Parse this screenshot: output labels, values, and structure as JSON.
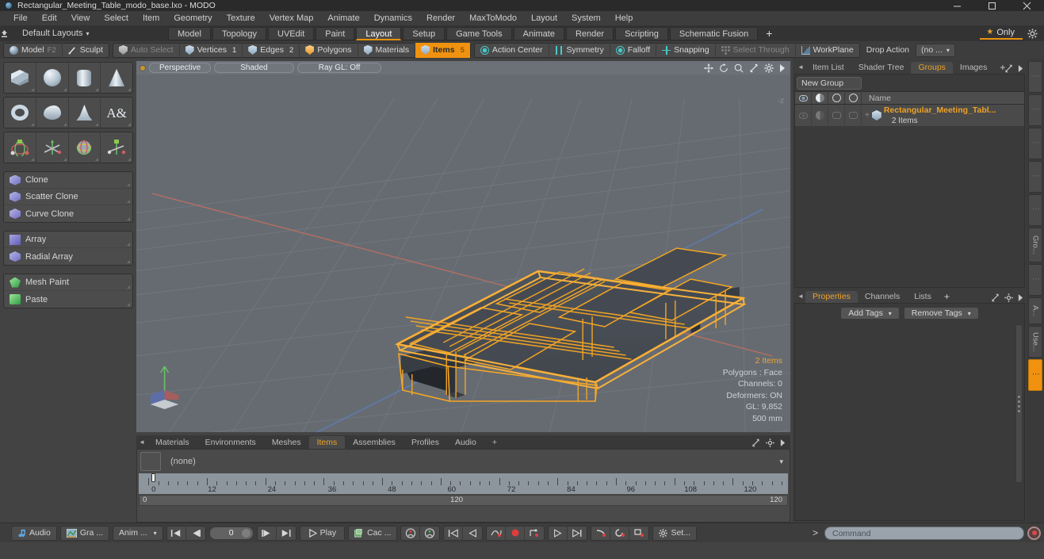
{
  "window": {
    "title": "Rectangular_Meeting_Table_modo_base.lxo - MODO",
    "app_icon": "modo-logo-icon",
    "minimize": "–",
    "maximize": "□",
    "close": "✕"
  },
  "menubar": {
    "items": [
      "File",
      "Edit",
      "View",
      "Select",
      "Item",
      "Geometry",
      "Texture",
      "Vertex Map",
      "Animate",
      "Dynamics",
      "Render",
      "MaxToModo",
      "Layout",
      "System",
      "Help"
    ]
  },
  "layout_bar": {
    "preset_label": "Default Layouts",
    "preset_caret": "▾",
    "tabs": [
      {
        "label": "Model",
        "active": false
      },
      {
        "label": "Topology",
        "active": false
      },
      {
        "label": "UVEdit",
        "active": false
      },
      {
        "label": "Paint",
        "active": false
      },
      {
        "label": "Layout",
        "active": true
      },
      {
        "label": "Setup",
        "active": false
      },
      {
        "label": "Game Tools",
        "active": false
      },
      {
        "label": "Animate",
        "active": false
      },
      {
        "label": "Render",
        "active": false
      },
      {
        "label": "Scripting",
        "active": false
      },
      {
        "label": "Schematic Fusion",
        "active": false
      }
    ],
    "add_tab": "+",
    "only_label": "Only",
    "only_star": "★",
    "gear": "gear-icon"
  },
  "mode_toolbar": {
    "left_group": [
      {
        "label": "Model",
        "icon": "sphere-icon",
        "shortcut": "F2",
        "state": "normal"
      },
      {
        "label": "Sculpt",
        "icon": "brush-icon",
        "shortcut": "",
        "state": "normal"
      }
    ],
    "selection_group": [
      {
        "label": "Auto Select",
        "icon": "shield-icon",
        "count": "",
        "state": "dim"
      },
      {
        "label": "Vertices",
        "icon": "shield-icon",
        "count": "1",
        "state": "normal"
      },
      {
        "label": "Edges",
        "icon": "shield-icon",
        "count": "2",
        "state": "normal"
      },
      {
        "label": "Polygons",
        "icon": "shield-icon",
        "count": "",
        "state": "normal"
      },
      {
        "label": "Materials",
        "icon": "shield-icon",
        "count": "",
        "state": "normal"
      },
      {
        "label": "Items",
        "icon": "shield-icon",
        "count": "5",
        "state": "active"
      }
    ],
    "right_group": [
      {
        "label": "Action Center",
        "icon": "action-center-icon",
        "state": "normal"
      },
      {
        "label": "Symmetry",
        "icon": "symmetry-icon",
        "state": "normal"
      },
      {
        "label": "Falloff",
        "icon": "falloff-icon",
        "state": "normal"
      },
      {
        "label": "Snapping",
        "icon": "snapping-icon",
        "state": "normal"
      },
      {
        "label": "Select Through",
        "icon": "select-through-icon",
        "state": "dim"
      },
      {
        "label": "WorkPlane",
        "icon": "workplane-icon",
        "state": "normal"
      }
    ],
    "drop_action_label": "Drop Action",
    "drop_action_value": "(no ...",
    "drop_action_caret": "▾"
  },
  "left_toolbar": {
    "primitive_rows": [
      [
        {
          "name": "cube-tool",
          "glyph": "cube"
        },
        {
          "name": "sphere-tool",
          "glyph": "sphere"
        },
        {
          "name": "cylinder-tool",
          "glyph": "cylinder"
        },
        {
          "name": "cone-tool",
          "glyph": "cone"
        }
      ],
      [
        {
          "name": "torus-tool",
          "glyph": "torus"
        },
        {
          "name": "teapot-tool",
          "glyph": "teapot"
        },
        {
          "name": "prism-tool",
          "glyph": "bell"
        },
        {
          "name": "text-tool",
          "glyph": "text"
        }
      ],
      [
        {
          "name": "transform-tool",
          "glyph": "xyz1"
        },
        {
          "name": "move-tool",
          "glyph": "xyz2"
        },
        {
          "name": "rotate-tool",
          "glyph": "xyz3"
        },
        {
          "name": "scale-tool",
          "glyph": "xyz4"
        }
      ]
    ],
    "clone_group": [
      {
        "label": "Clone",
        "icon": "clone-icon"
      },
      {
        "label": "Scatter Clone",
        "icon": "scatter-clone-icon"
      },
      {
        "label": "Curve Clone",
        "icon": "curve-clone-icon"
      }
    ],
    "array_group": [
      {
        "label": "Array",
        "icon": "array-icon"
      },
      {
        "label": "Radial Array",
        "icon": "radial-array-icon"
      }
    ],
    "paint_group": [
      {
        "label": "Mesh Paint",
        "icon": "mesh-paint-icon"
      },
      {
        "label": "Paste",
        "icon": "paste-icon"
      }
    ]
  },
  "viewport": {
    "view_mode": "Perspective",
    "shading_mode": "Shaded",
    "raygl": "Ray GL: Off",
    "header_icons": [
      "move-view-icon",
      "rotate-view-icon",
      "zoom-view-icon",
      "fit-view-icon",
      "gear-icon",
      "chevron-right-icon"
    ],
    "z_marker": "-z",
    "stats": {
      "items": "2 Items",
      "polygons": "Polygons : Face",
      "channels": "Channels: 0",
      "deformers": "Deformers: ON",
      "gl": "GL: 9,852",
      "scale": "500 mm"
    },
    "model": {
      "name": "Rectangular Meeting Table",
      "wireframe_color": "#f5a623",
      "surface_color": "#4a4f56",
      "background_color": "#666b72",
      "grid_color": "#7a8087",
      "x_axis_color": "#c06a5a",
      "z_axis_color": "#5a7ec0",
      "y_axis_color": "#6ac06a"
    }
  },
  "bottom_editor": {
    "tabs": [
      {
        "label": "Materials",
        "active": false
      },
      {
        "label": "Environments",
        "active": false
      },
      {
        "label": "Meshes",
        "active": false
      },
      {
        "label": "Items",
        "active": true
      },
      {
        "label": "Assemblies",
        "active": false
      },
      {
        "label": "Profiles",
        "active": false
      },
      {
        "label": "Audio",
        "active": false
      }
    ],
    "add_tab": "+",
    "selection_value": "(none)",
    "dropdown_caret": "▾",
    "timeline": {
      "tick_labels": [
        "0",
        "12",
        "24",
        "36",
        "48",
        "60",
        "72",
        "84",
        "96",
        "108",
        "120"
      ],
      "playhead_frame": "0",
      "range_start": "0",
      "range_mid": "120",
      "range_end": "120"
    }
  },
  "right_panel": {
    "top_tabs": [
      {
        "label": "Item List",
        "active": false
      },
      {
        "label": "Shader Tree",
        "active": false
      },
      {
        "label": "Groups",
        "active": true
      },
      {
        "label": "Images",
        "active": false
      }
    ],
    "add_tab": "+",
    "new_group_label": "New Group",
    "columns": [
      "eye-icon",
      "shade-icon",
      "lock-icon",
      "render-icon",
      "Name"
    ],
    "name_column": "Name",
    "rows": [
      {
        "name": "Rectangular_Meeting_Tabl...",
        "sub": "2 Items",
        "icon": "mesh-item-icon",
        "expand": "+"
      }
    ],
    "bottom_tabs": [
      {
        "label": "Properties",
        "active": true
      },
      {
        "label": "Channels",
        "active": false
      },
      {
        "label": "Lists",
        "active": false
      }
    ],
    "bottom_add_tab": "+",
    "tag_buttons": [
      {
        "label": "Add Tags",
        "caret": "▾"
      },
      {
        "label": "Remove Tags",
        "caret": "▾"
      }
    ]
  },
  "vertical_tabs": [
    {
      "label": "",
      "active": false
    },
    {
      "label": "",
      "active": false
    },
    {
      "label": "",
      "active": false
    },
    {
      "label": "",
      "active": false
    },
    {
      "label": "",
      "active": false
    },
    {
      "label": "Gro...",
      "active": false
    },
    {
      "label": "",
      "active": false
    },
    {
      "label": "A...",
      "active": false
    },
    {
      "label": "Use...",
      "active": false
    },
    {
      "label": "",
      "active": true
    }
  ],
  "playback_bar": {
    "buttons": [
      {
        "label": "Audio",
        "icon": "audio-note-icon",
        "name": "audio-button"
      },
      {
        "label": "Gra ...",
        "icon": "graph-editor-icon",
        "name": "graph-editor-button"
      },
      {
        "label": "Anim ...",
        "icon": "",
        "caret": "▾",
        "name": "anim-dropdown"
      }
    ],
    "transport": {
      "go_start": "⏮",
      "step_back": "⏪",
      "frame_value": "0",
      "step_fwd": "⏩",
      "go_end": "⏭",
      "play_label": "Play",
      "play_icon": "▶"
    },
    "cache_button": {
      "label": "Cac ...",
      "icon": "cache-icon"
    },
    "key_buttons": [
      {
        "name": "key-prev-icon"
      },
      {
        "name": "key-next-icon"
      },
      {
        "name": "key-first-icon"
      },
      {
        "name": "key-back-icon"
      },
      {
        "name": "key-curve-icon"
      },
      {
        "name": "record-key-icon"
      },
      {
        "name": "key-graph-icon"
      },
      {
        "name": "key-forward-icon"
      },
      {
        "name": "key-last-icon"
      },
      {
        "name": "key-delete-icon"
      },
      {
        "name": "key-reload-icon"
      },
      {
        "name": "key-remove-icon"
      }
    ],
    "settings_label": "Set...",
    "settings_icon": "gear-icon",
    "command_placeholder": "Command",
    "command_prompt": ">",
    "command_record": "record-icon"
  }
}
